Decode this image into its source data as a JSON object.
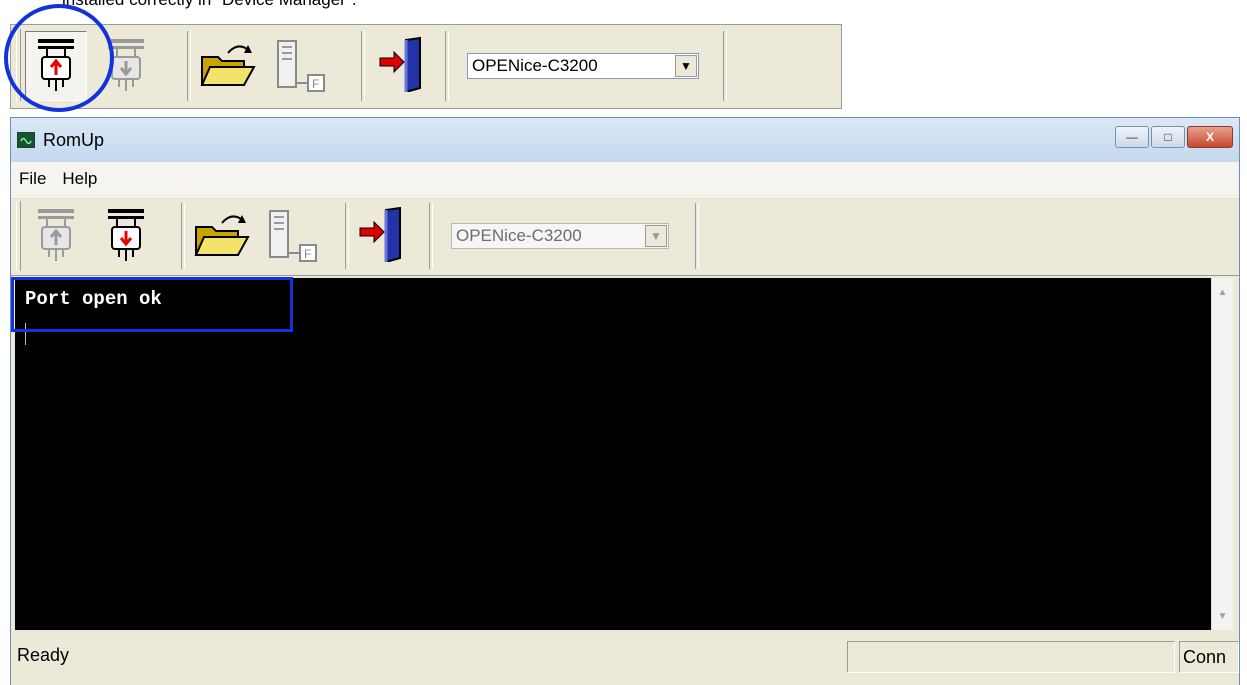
{
  "doc_caption": "installed correctly in \"Device Manager\".",
  "strip_toolbar": {
    "buttons": [
      {
        "name": "connect-icon"
      },
      {
        "name": "disconnect-icon"
      },
      {
        "name": "open-folder-icon"
      },
      {
        "name": "flash-file-icon"
      },
      {
        "name": "exit-door-icon"
      }
    ],
    "device_select": "OPENice-C3200"
  },
  "window": {
    "title": "RomUp",
    "controls": {
      "minimize": "—",
      "maximize": "□",
      "close": "X"
    },
    "menu": [
      "File",
      "Help"
    ],
    "toolbar": {
      "device_select": "OPENice-C3200"
    },
    "console": {
      "line": "Port open ok"
    },
    "status": {
      "text": "Ready",
      "right_panel": "Conn"
    }
  },
  "colors": {
    "highlight": "#1133dd",
    "console_bg": "#000000",
    "console_fg": "#ffffff",
    "chrome": "#ece9d8"
  }
}
